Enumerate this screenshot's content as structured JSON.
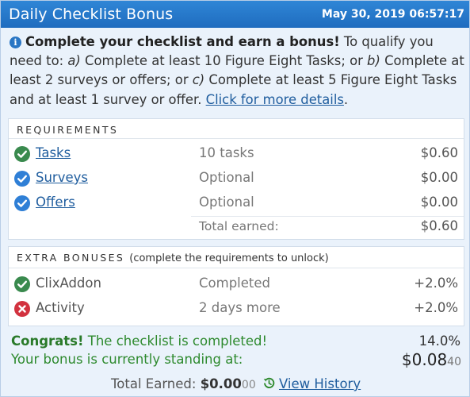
{
  "header": {
    "title": "Daily Checklist Bonus",
    "datetime": "May 30, 2019 06:57:17"
  },
  "intro": {
    "bold": "Complete your checklist and earn a bonus!",
    "text1": " To qualify you need to: ",
    "opt_a": "a)",
    "text2": " Complete at least 10 Figure Eight Tasks; or ",
    "opt_b": "b)",
    "text3": " Complete at least 2 surveys or offers; or ",
    "opt_c": "c)",
    "text4": " Complete at least 5 Figure Eight Tasks and at least 1 survey or offer. ",
    "link": "Click for more details",
    "end": "."
  },
  "requirements": {
    "heading": "REQUIREMENTS",
    "rows": [
      {
        "name": "Tasks",
        "requirement": "10 tasks",
        "amount": "$0.60",
        "icon": "check-green-icon"
      },
      {
        "name": "Surveys",
        "requirement": "Optional",
        "amount": "$0.00",
        "icon": "check-blue-icon"
      },
      {
        "name": "Offers",
        "requirement": "Optional",
        "amount": "$0.00",
        "icon": "check-blue-icon"
      }
    ],
    "total_label": "Total earned:",
    "total_amount": "$0.60"
  },
  "extra": {
    "heading": "EXTRA BONUSES",
    "subheading": "(complete the requirements to unlock)",
    "rows": [
      {
        "name": "ClixAddon",
        "status": "Completed",
        "amount": "+2.0%",
        "icon": "check-green-icon"
      },
      {
        "name": "Activity",
        "status": "2 days more",
        "amount": "+2.0%",
        "icon": "x-red-icon"
      }
    ]
  },
  "summary": {
    "congrats_bold": "Congrats!",
    "congrats_text": " The checklist is completed!",
    "percent": "14.0%",
    "bonus_label": "Your bonus is currently standing at:",
    "bonus_main": "$0.08",
    "bonus_frac": "40",
    "earned_label": "Total Earned: ",
    "earned_main": "$0.00",
    "earned_frac": "00",
    "history_link": "View History"
  },
  "colors": {
    "header_blue": "#2a7cd0",
    "check_green": "#3a8a4e",
    "check_blue": "#2f7fd6",
    "x_red": "#d2323f",
    "congrats_green": "#2e8a2e",
    "link_blue": "#1f5d9e"
  }
}
